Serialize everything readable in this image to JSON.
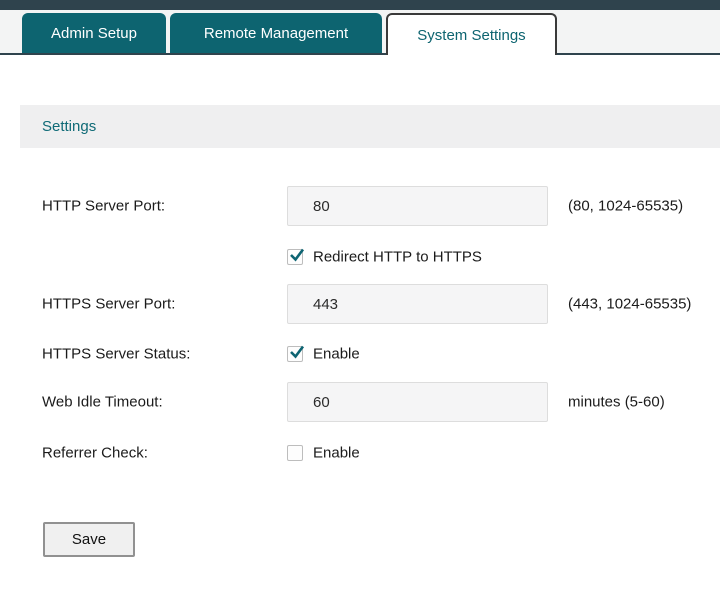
{
  "tabs": [
    {
      "label": "Admin Setup",
      "active": false
    },
    {
      "label": "Remote Management",
      "active": false
    },
    {
      "label": "System Settings",
      "active": true
    }
  ],
  "section": {
    "title": "Settings"
  },
  "fields": {
    "http_port": {
      "label": "HTTP Server Port:",
      "value": "80",
      "hint": "(80, 1024-65535)"
    },
    "redirect": {
      "label": "Redirect HTTP to HTTPS",
      "checked": true
    },
    "https_port": {
      "label": "HTTPS Server Port:",
      "value": "443",
      "hint": "(443, 1024-65535)"
    },
    "https_status": {
      "label": "HTTPS Server Status:",
      "checkbox_label": "Enable",
      "checked": true
    },
    "web_idle_timeout": {
      "label": "Web Idle Timeout:",
      "value": "60",
      "hint": "minutes (5-60)"
    },
    "referrer_check": {
      "label": "Referrer Check:",
      "checkbox_label": "Enable",
      "checked": false
    }
  },
  "buttons": {
    "save": "Save"
  },
  "colors": {
    "teal": "#0d6470",
    "top_bar": "#2f434d",
    "section_bg": "#efeff0",
    "check": "#0d6472"
  }
}
